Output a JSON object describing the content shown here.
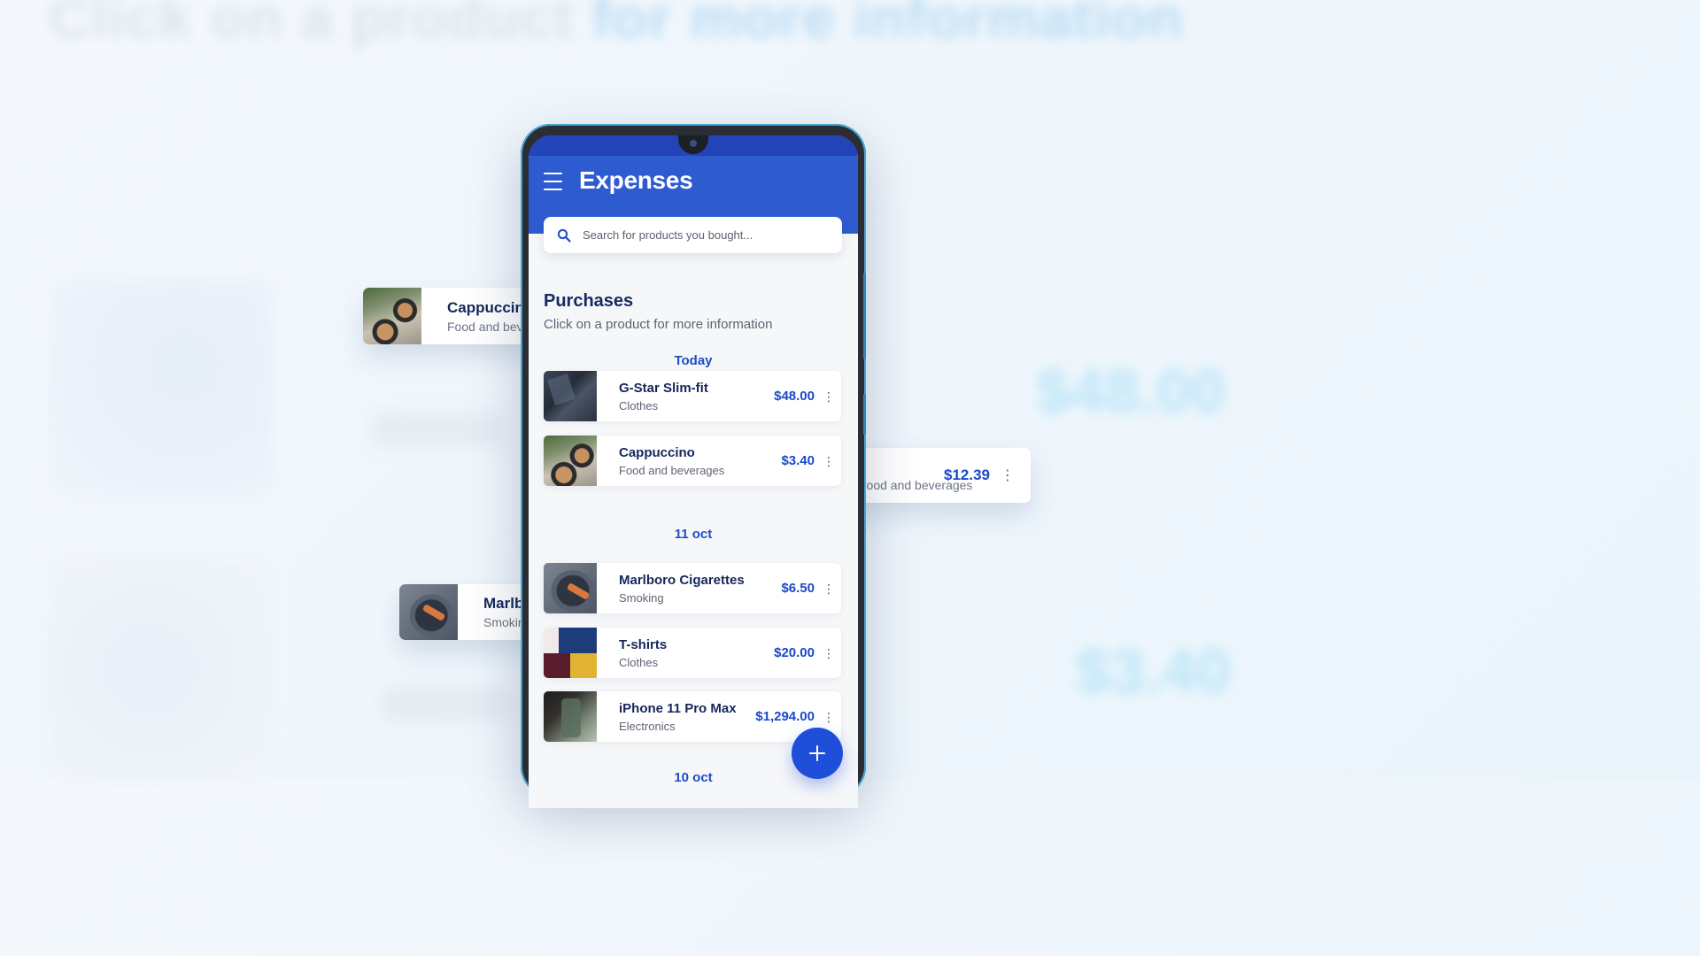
{
  "background": {
    "heading_part1": "Click on a product ",
    "heading_part2": "for more information",
    "price_1": "$48.00",
    "price_2": "$3.40"
  },
  "floating_cards": {
    "left_1": {
      "name": "Cappuccino",
      "category": "Food and beverages"
    },
    "left_2": {
      "name": "Marlboro Cigarettes",
      "category": "Smoking"
    },
    "right": {
      "category": "Food and beverages",
      "price": "$12.39"
    }
  },
  "app": {
    "title": "Expenses",
    "search_placeholder": "Search for products you bought...",
    "section_title": "Purchases",
    "section_subtitle": "Click on a product for more information",
    "groups": [
      {
        "date": "Today",
        "items": [
          {
            "name": "G-Star Slim-fit",
            "category": "Clothes",
            "price": "$48.00",
            "thumb": "jeans"
          },
          {
            "name": "Cappuccino",
            "category": "Food and beverages",
            "price": "$3.40",
            "thumb": "coffee"
          }
        ]
      },
      {
        "date": "11 oct",
        "items": [
          {
            "name": "Marlboro Cigarettes",
            "category": "Smoking",
            "price": "$6.50",
            "thumb": "cigarettes"
          },
          {
            "name": "T-shirts",
            "category": "Clothes",
            "price": "$20.00",
            "thumb": "tshirts"
          },
          {
            "name": "iPhone 11 Pro Max",
            "category": "Electronics",
            "price": "$1,294.00",
            "thumb": "iphone"
          }
        ]
      },
      {
        "date": "10 oct",
        "items": []
      }
    ],
    "fab_icon": "plus-icon"
  },
  "colors": {
    "app_bar": "#2f5bd1",
    "accent": "#1a49c9",
    "fab": "#1f4fd8",
    "title_text": "#162a63"
  }
}
